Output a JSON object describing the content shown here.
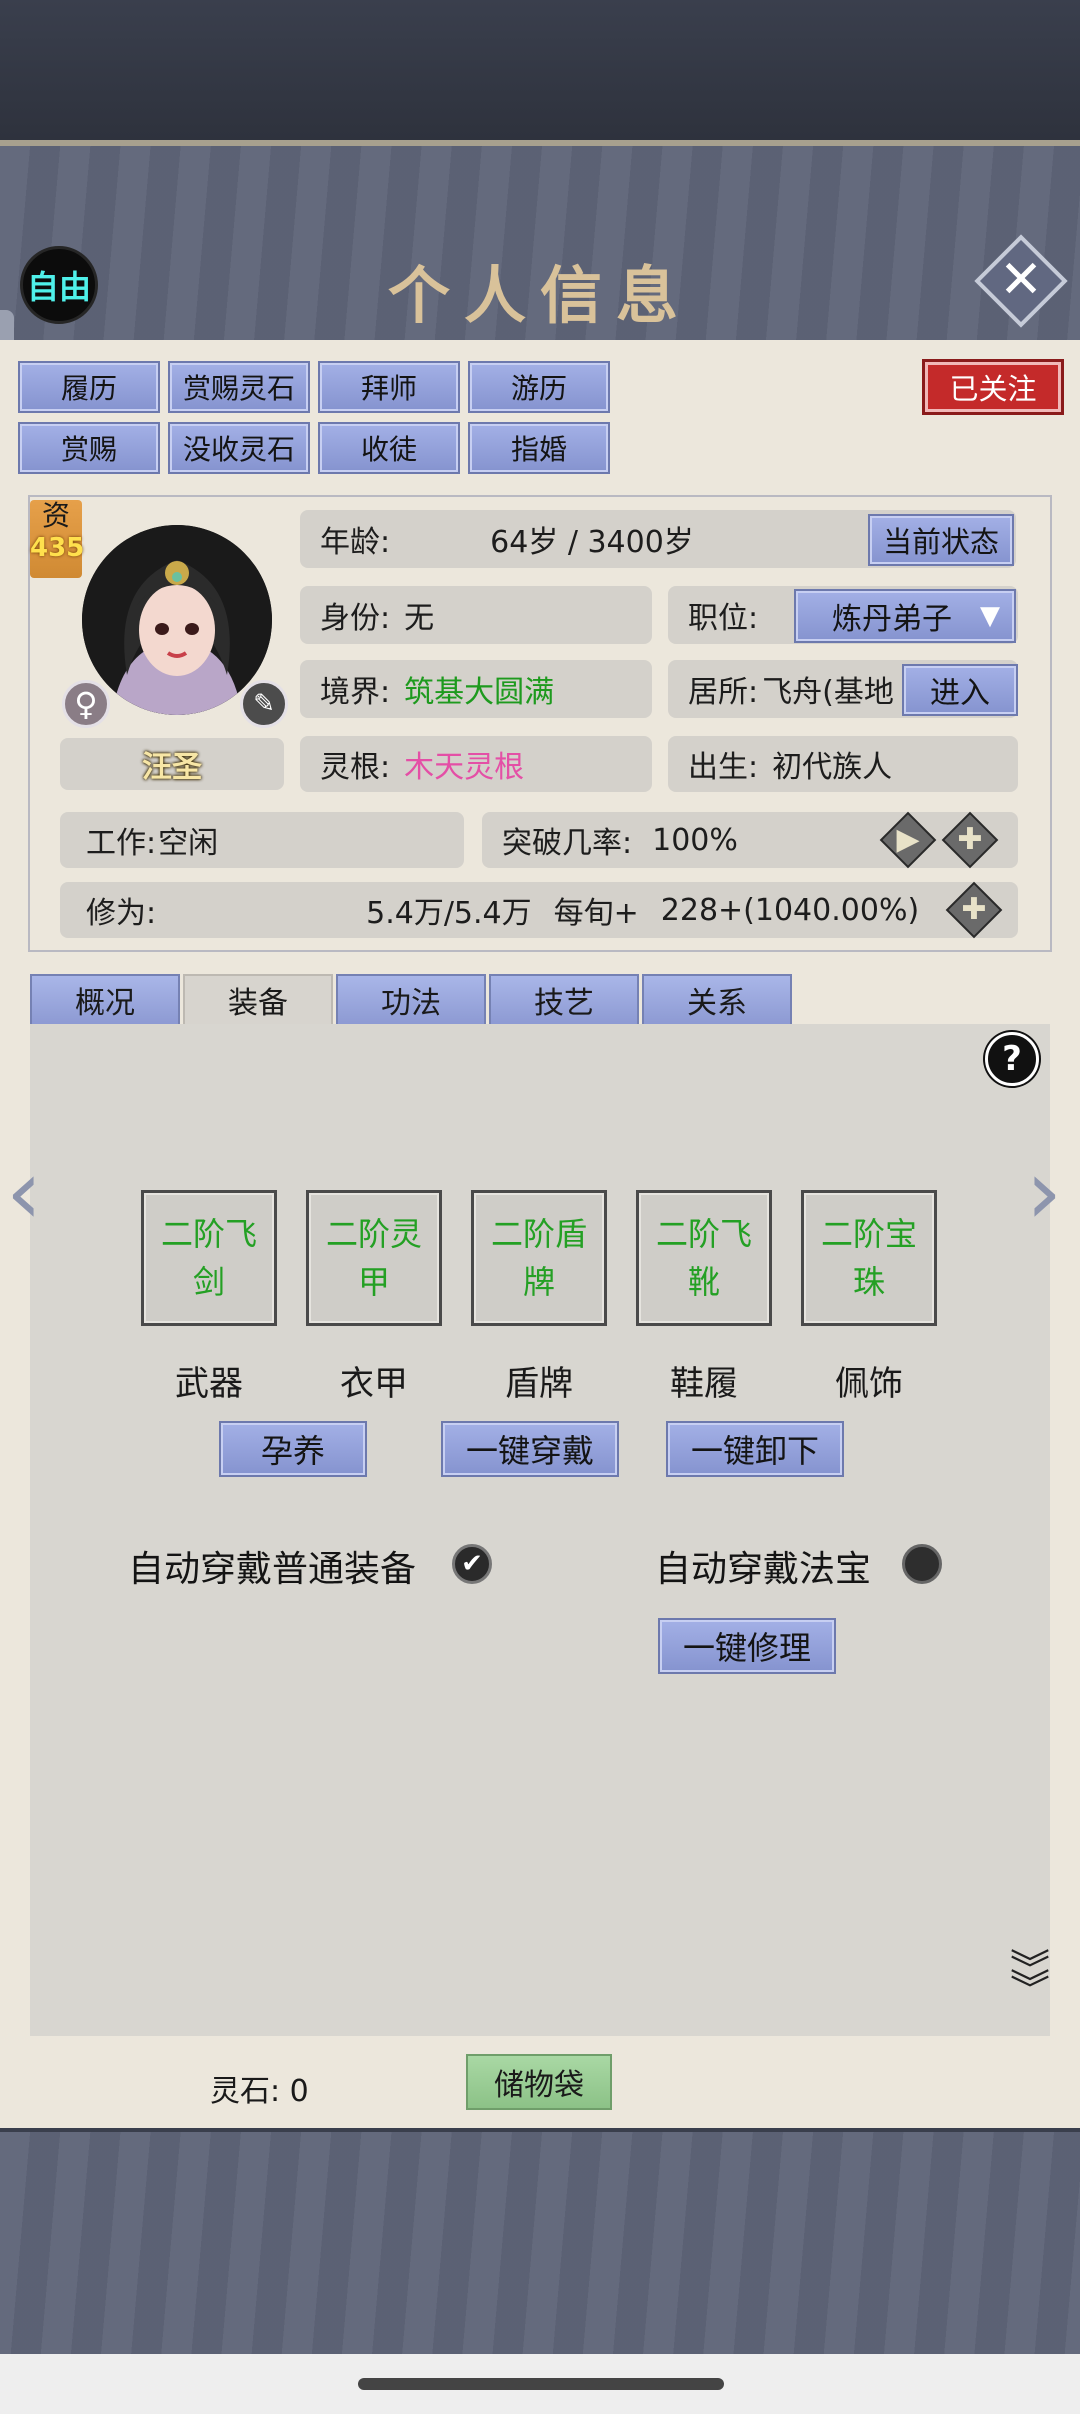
{
  "header": {
    "title": "个人信息",
    "auto_label": "自由",
    "close_icon": "close-icon"
  },
  "actions": {
    "row1": [
      "履历",
      "赏赐灵石",
      "拜师",
      "游历"
    ],
    "row2": [
      "赏赐",
      "没收灵石",
      "收徒",
      "指婚"
    ],
    "follow_label": "已关注"
  },
  "profile": {
    "aptitude_label": "资",
    "aptitude_value": "435",
    "name": "汪圣",
    "gender_icon": "♀",
    "age_label": "年龄:",
    "age_value": "64岁 / 3400岁",
    "status_button": "当前状态",
    "identity_label": "身份:",
    "identity_value": "无",
    "position_label": "职位:",
    "position_value": "炼丹弟子",
    "realm_label": "境界:",
    "realm_value": "筑基大圆满",
    "residence_label": "居所:",
    "residence_value": "飞舟(基地",
    "enter_button": "进入",
    "root_label": "灵根:",
    "root_value": "木天灵根",
    "birth_label": "出生:",
    "birth_value": "初代族人",
    "work_label": "工作:",
    "work_value": "空闲",
    "breakthrough_label": "突破几率:",
    "breakthrough_value": "100%",
    "cultivation_label": "修为:",
    "cultivation_value": "5.4万/5.4万",
    "per_turn_label": "每旬+",
    "per_turn_value": "228+(1040.00%)"
  },
  "tabs": [
    {
      "label": "概况",
      "active": false
    },
    {
      "label": "装备",
      "active": true
    },
    {
      "label": "功法",
      "active": false
    },
    {
      "label": "技艺",
      "active": false
    },
    {
      "label": "关系",
      "active": false
    }
  ],
  "equipment": {
    "slots": [
      {
        "item": "二阶飞剑",
        "label": "武器"
      },
      {
        "item": "二阶灵甲",
        "label": "衣甲"
      },
      {
        "item": "二阶盾牌",
        "label": "盾牌"
      },
      {
        "item": "二阶飞靴",
        "label": "鞋履"
      },
      {
        "item": "二阶宝珠",
        "label": "佩饰"
      }
    ],
    "nurture_button": "孕养",
    "equip_all_button": "一键穿戴",
    "unequip_all_button": "一键卸下",
    "auto_equip_normal_label": "自动穿戴普通装备",
    "auto_equip_normal_checked": true,
    "auto_equip_treasure_label": "自动穿戴法宝",
    "auto_equip_treasure_checked": false,
    "repair_button": "一键修理"
  },
  "footer": {
    "spirit_stone_label": "灵石:",
    "spirit_stone_value": "0",
    "storage_bag_button": "储物袋"
  },
  "colors": {
    "accent_blue": "#8d9ad3",
    "realm_green": "#1e9a1e",
    "root_pink": "#e44fa6",
    "follow_red": "#c42a2a"
  }
}
